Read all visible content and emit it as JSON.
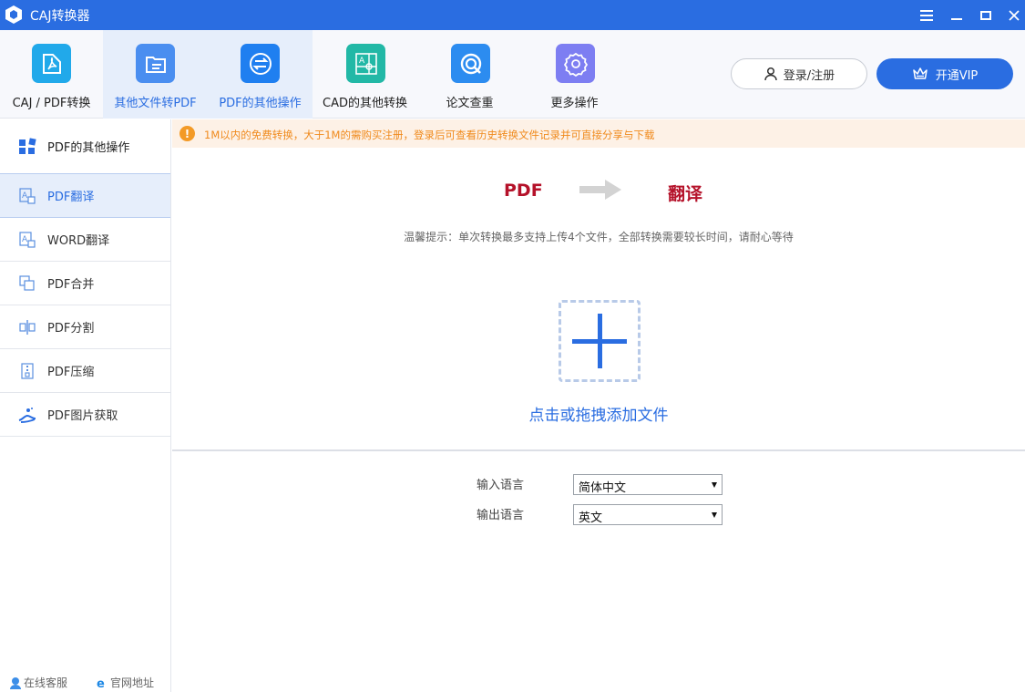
{
  "window": {
    "title": "CAJ转换器",
    "colors": {
      "primary": "#2a6de1",
      "warning": "#f39a26",
      "accent_red": "#b5122a"
    }
  },
  "toolbar": {
    "tabs": [
      {
        "label": "CAJ / PDF转换",
        "icon": "pdf-convert-icon",
        "color": "#21a9ea",
        "active": false
      },
      {
        "label": "其他文件转PDF",
        "icon": "folder-file-icon",
        "color": "#4a8ef0",
        "active": true
      },
      {
        "label": "PDF的其他操作",
        "icon": "swap-arrows-icon",
        "color": "#1f7ff0",
        "active": false
      },
      {
        "label": "CAD的其他转换",
        "icon": "cad-drawing-icon",
        "color": "#22b8a6",
        "active": false
      },
      {
        "label": "论文查重",
        "icon": "check-circle-icon",
        "color": "#2c8cf0",
        "active": false
      },
      {
        "label": "更多操作",
        "icon": "gear-icon",
        "color": "#7d7ef2",
        "active": false
      }
    ],
    "login_label": "登录/注册",
    "vip_label": "开通VIP"
  },
  "sidebar": {
    "header": "PDF的其他操作",
    "items": [
      {
        "label": "PDF翻译",
        "icon": "translate-icon",
        "active": true
      },
      {
        "label": "WORD翻译",
        "icon": "translate-icon",
        "active": false
      },
      {
        "label": "PDF合并",
        "icon": "merge-icon",
        "active": false
      },
      {
        "label": "PDF分割",
        "icon": "split-icon",
        "active": false
      },
      {
        "label": "PDF压缩",
        "icon": "compress-icon",
        "active": false
      },
      {
        "label": "PDF图片获取",
        "icon": "image-extract-icon",
        "active": false
      }
    ],
    "footer": {
      "service": "在线客服",
      "website": "官网地址"
    }
  },
  "notice": "1M以内的免费转换，大于1M的需购买注册，登录后可查看历史转换文件记录并可直接分享与下载",
  "main": {
    "flow_from": "PDF",
    "flow_to": "翻译",
    "tip": "温馨提示：单次转换最多支持上传4个文件，全部转换需要较长时间，请耐心等待",
    "drop_label": "点击或拖拽添加文件",
    "input_language": {
      "label": "输入语言",
      "value": "简体中文"
    },
    "output_language": {
      "label": "输出语言",
      "value": "英文"
    }
  }
}
